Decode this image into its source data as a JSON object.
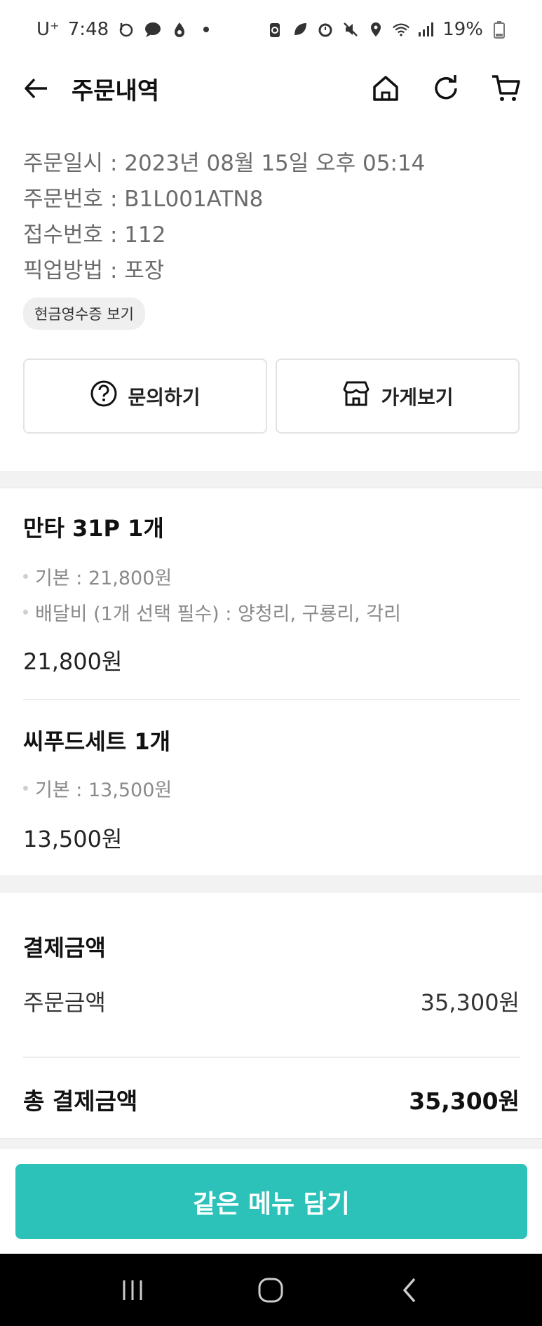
{
  "status_bar": {
    "carrier": "U⁺",
    "time": "7:48",
    "battery": "19%"
  },
  "header": {
    "title": "주문내역",
    "icons": [
      "back-arrow-icon",
      "home-icon",
      "refresh-icon",
      "cart-icon"
    ]
  },
  "order_info": {
    "rows": [
      {
        "label": "주문일시",
        "value": "2023년 08월 15일 오후 05:14"
      },
      {
        "label": "주문번호",
        "value": "B1L001ATN8"
      },
      {
        "label": "접수번호",
        "value": "112"
      },
      {
        "label": "픽업방법",
        "value": "포장"
      }
    ],
    "receipt_chip": "현금영수증 보기"
  },
  "actions": {
    "inquiry_label": "문의하기",
    "store_label": "가게보기"
  },
  "items": [
    {
      "title": "만타 31P 1개",
      "options": [
        "기본 : 21,800원",
        "배달비 (1개 선택 필수) : 양청리, 구룡리, 각리"
      ],
      "price": "21,800원"
    },
    {
      "title": "씨푸드세트 1개",
      "options": [
        "기본 : 13,500원"
      ],
      "price": "13,500원"
    }
  ],
  "payment": {
    "title": "결제금액",
    "order_amount_label": "주문금액",
    "order_amount_value": "35,300원",
    "total_label": "총 결제금액",
    "total_value": "35,300원"
  },
  "cta_label": "같은 메뉴 담기",
  "colors": {
    "accent": "#2cc2ba"
  }
}
